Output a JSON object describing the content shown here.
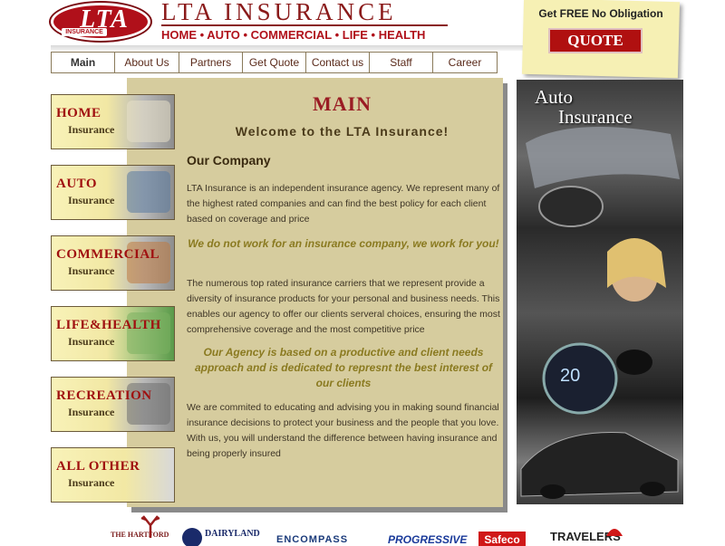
{
  "header": {
    "logo_text": "LTA",
    "logo_subtext": "INSURANCE",
    "brand_title": "LTA INSURANCE",
    "lines_of_business": "HOME • AUTO • COMMERCIAL • LIFE • HEALTH"
  },
  "promo": {
    "text": "Get FREE No Obligation",
    "quote_label": "QUOTE"
  },
  "nav": {
    "tabs": [
      {
        "label": "Main"
      },
      {
        "label": "About Us"
      },
      {
        "label": "Partners"
      },
      {
        "label": "Get Quote"
      },
      {
        "label": "Contact us"
      },
      {
        "label": "Staff"
      },
      {
        "label": "Career"
      }
    ]
  },
  "sidebar": {
    "items": [
      {
        "title": "HOME",
        "subtitle": "Insurance"
      },
      {
        "title": "AUTO",
        "subtitle": "Insurance"
      },
      {
        "title": "COMMERCIAL",
        "subtitle": "Insurance"
      },
      {
        "title": "LIFE&HEALTH",
        "subtitle": "Insurance"
      },
      {
        "title": "RECREATION",
        "subtitle": "Insurance"
      },
      {
        "title": "ALL OTHER",
        "subtitle": "Insurance"
      }
    ]
  },
  "main": {
    "heading": "MAIN",
    "welcome": "Welcome to the LTA Insurance!",
    "section_heading": "Our Company",
    "para1": "LTA Insurance is an independent insurance agency. We represent many of the highest rated companies and can find the best policy for each client based on coverage and price",
    "callout1": "We do not work for an insurance company, we work for you!",
    "para2": "The numerous top rated insurance carriers that we represent provide a diversity of insurance products for your personal and business needs. This enables our agency to offer our clients serveral choices, ensuring the most comprehensive coverage and the most competitive price",
    "callout2": "Our Agency is based on a productive and client needs approach and is dedicated to represnt the best interest of our clients",
    "para3": "We are commited to educating and advising you in making sound financial insurance decisions to protect your business and the people that you love. With us, you will understand the difference between having insurance and being properly insured"
  },
  "ad": {
    "line1": "Auto",
    "line2": "Insurance"
  },
  "carriers": {
    "hartford": "THE HARTFORD",
    "dairyland": "DAIRYLAND",
    "encompass": "ENCOMPASS",
    "progressive": "PROGRESSIVE",
    "safeco": "Safeco",
    "travelers": "TRAVELERS"
  },
  "colors": {
    "brand_red": "#9a1c24",
    "panel_tan": "#d6cc9e",
    "callout_olive": "#8a7a20"
  }
}
